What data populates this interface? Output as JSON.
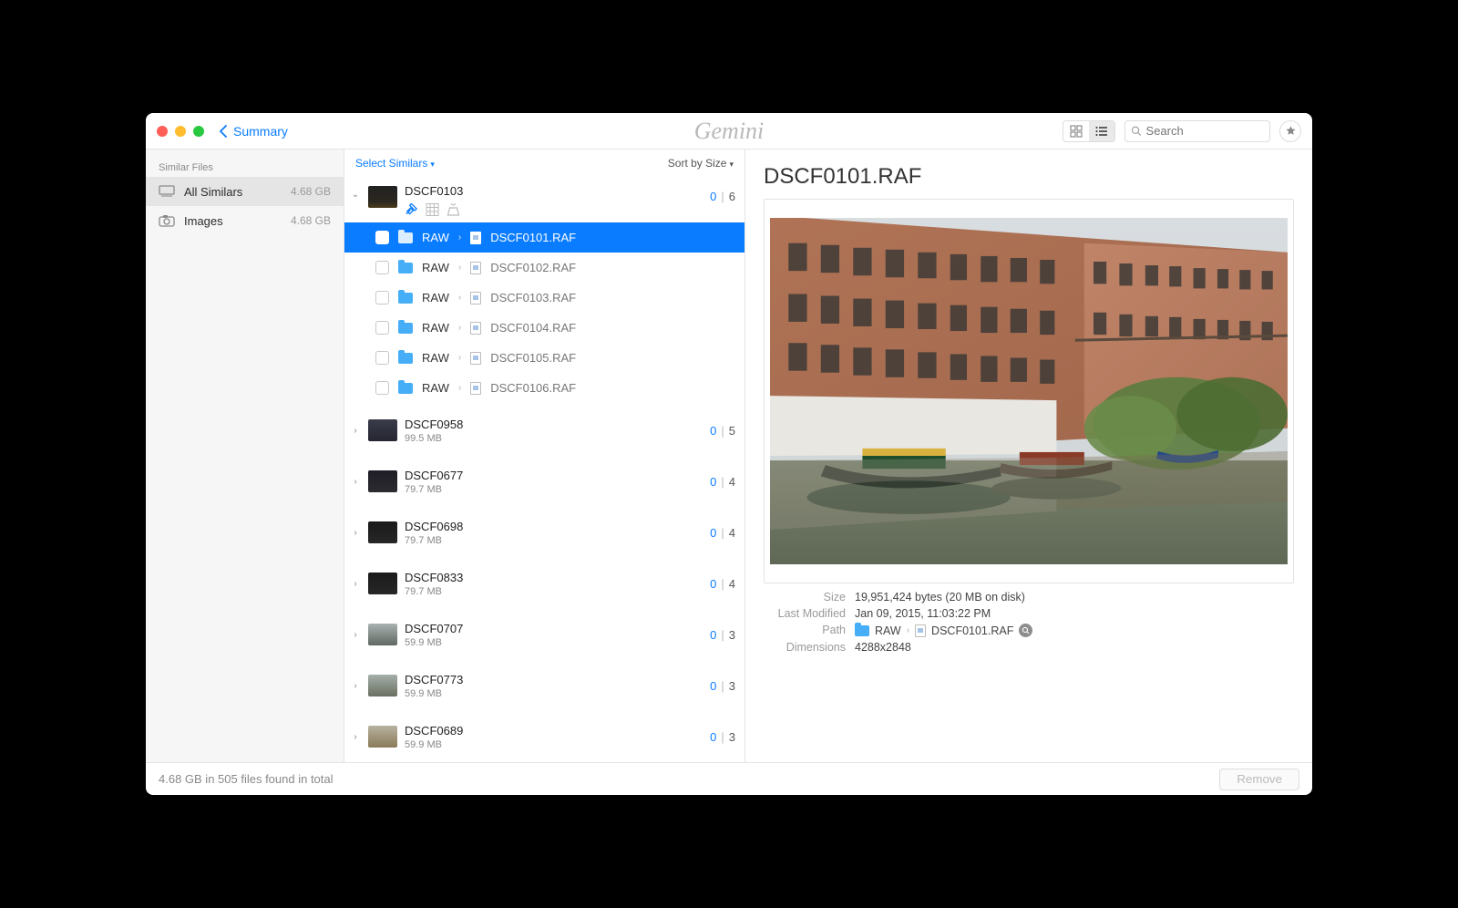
{
  "app_name": "Gemini",
  "back_label": "Summary",
  "search_placeholder": "Search",
  "sidebar": {
    "header": "Similar Files",
    "items": [
      {
        "label": "All Similars",
        "size": "4.68 GB",
        "icon": "stack-icon",
        "selected": true
      },
      {
        "label": "Images",
        "size": "4.68 GB",
        "icon": "camera-icon",
        "selected": false
      }
    ]
  },
  "mid": {
    "select_label": "Select Similars",
    "sort_label": "Sort by Size"
  },
  "groups": [
    {
      "name": "DSCF0103",
      "sel": "0",
      "total": "6",
      "expanded": true,
      "thumb": "dark1",
      "files": [
        {
          "folder": "RAW",
          "file": "DSCF0101.RAF",
          "selected": true
        },
        {
          "folder": "RAW",
          "file": "DSCF0102.RAF",
          "selected": false
        },
        {
          "folder": "RAW",
          "file": "DSCF0103.RAF",
          "selected": false
        },
        {
          "folder": "RAW",
          "file": "DSCF0104.RAF",
          "selected": false
        },
        {
          "folder": "RAW",
          "file": "DSCF0105.RAF",
          "selected": false
        },
        {
          "folder": "RAW",
          "file": "DSCF0106.RAF",
          "selected": false
        }
      ]
    },
    {
      "name": "DSCF0958",
      "sub": "99.5 MB",
      "sel": "0",
      "total": "5",
      "thumb": "dark2"
    },
    {
      "name": "DSCF0677",
      "sub": "79.7 MB",
      "sel": "0",
      "total": "4",
      "thumb": "dark3"
    },
    {
      "name": "DSCF0698",
      "sub": "79.7 MB",
      "sel": "0",
      "total": "4",
      "thumb": "dark4"
    },
    {
      "name": "DSCF0833",
      "sub": "79.7 MB",
      "sel": "0",
      "total": "4",
      "thumb": "dark4"
    },
    {
      "name": "DSCF0707",
      "sub": "59.9 MB",
      "sel": "0",
      "total": "3",
      "thumb": "light1"
    },
    {
      "name": "DSCF0773",
      "sub": "59.9 MB",
      "sel": "0",
      "total": "3",
      "thumb": "light2"
    },
    {
      "name": "DSCF0689",
      "sub": "59.9 MB",
      "sel": "0",
      "total": "3",
      "thumb": "light3"
    }
  ],
  "detail": {
    "title": "DSCF0101.RAF",
    "meta": {
      "size_label": "Size",
      "size_value": "19,951,424 bytes (20 MB on disk)",
      "modified_label": "Last Modified",
      "modified_value": "Jan 09, 2015, 11:03:22 PM",
      "path_label": "Path",
      "path_folder": "RAW",
      "path_file": "DSCF0101.RAF",
      "dim_label": "Dimensions",
      "dim_value": "4288x2848"
    }
  },
  "footer": {
    "status": "4.68 GB in 505 files found in total",
    "remove_label": "Remove"
  }
}
